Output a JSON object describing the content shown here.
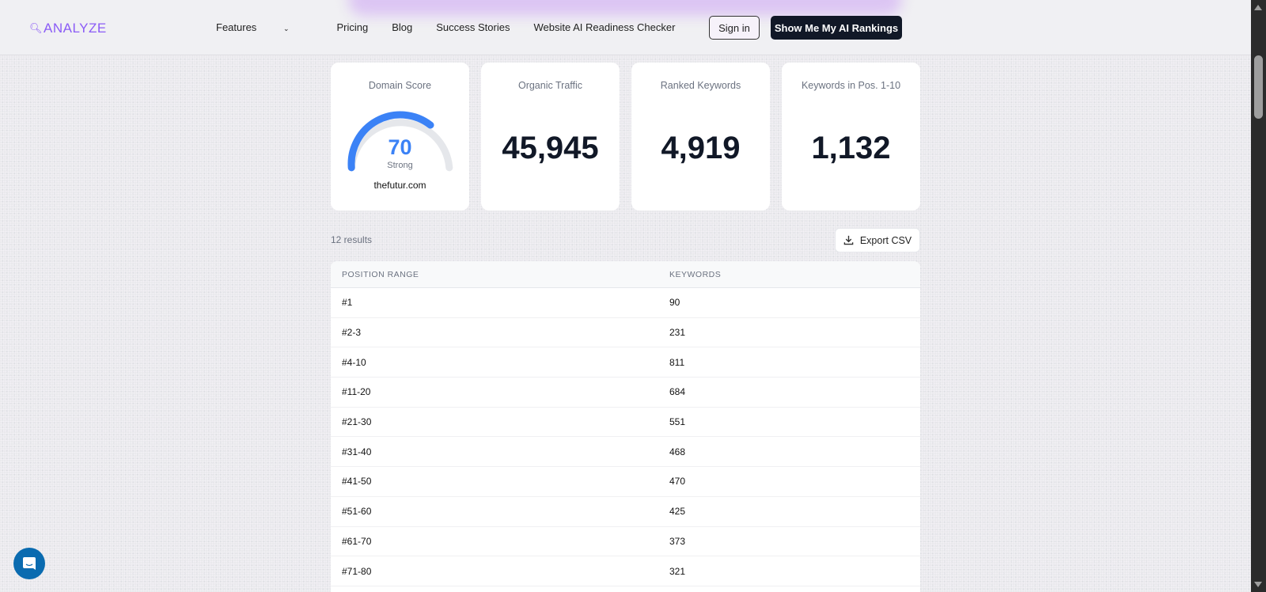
{
  "header": {
    "logo": "ANALYZE",
    "nav": [
      "Features",
      "Pricing",
      "Blog",
      "Success Stories",
      "Website AI Readiness Checker"
    ],
    "signin": "Sign in",
    "cta": "Show Me My AI Rankings"
  },
  "cards": {
    "domain_score": {
      "label": "Domain Score",
      "value": "70",
      "status": "Strong",
      "domain": "thefutur.com",
      "gauge_percent": 70,
      "color": "#3b82f6"
    },
    "organic_traffic": {
      "label": "Organic Traffic",
      "value": "45,945"
    },
    "ranked_keywords": {
      "label": "Ranked Keywords",
      "value": "4,919"
    },
    "top10": {
      "label": "Keywords in Pos. 1-10",
      "value": "1,132"
    }
  },
  "results": "12 results",
  "export": "Export CSV",
  "table": {
    "headers": [
      "POSITION RANGE",
      "KEYWORDS"
    ],
    "rows": [
      [
        "#1",
        "90"
      ],
      [
        "#2-3",
        "231"
      ],
      [
        "#4-10",
        "811"
      ],
      [
        "#11-20",
        "684"
      ],
      [
        "#21-30",
        "551"
      ],
      [
        "#31-40",
        "468"
      ],
      [
        "#41-50",
        "470"
      ],
      [
        "#51-60",
        "425"
      ],
      [
        "#61-70",
        "373"
      ],
      [
        "#71-80",
        "321"
      ]
    ]
  }
}
